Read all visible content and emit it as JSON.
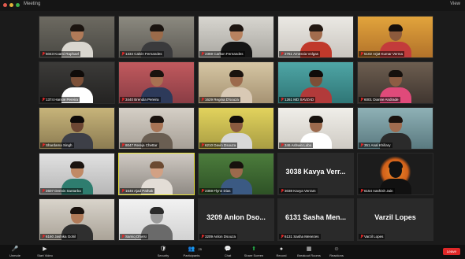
{
  "window": {
    "title": "Meeting",
    "view_label": "View"
  },
  "participants": [
    {
      "name": "5043 Koami Raphael",
      "look": "p1"
    },
    {
      "name": "1334 Calvin Fernandes",
      "look": "p2"
    },
    {
      "name": "2359 Carlton Fernandes",
      "look": "p3"
    },
    {
      "name": "2761 Amessia Volgas",
      "look": "p4"
    },
    {
      "name": "5102 Arjat Kumar Verma",
      "look": "p5"
    },
    {
      "name": "1374 Hansie Pereira",
      "look": "p6"
    },
    {
      "name": "3440 Brendia Pereira",
      "look": "p7"
    },
    {
      "name": "1629 Regina D'souza",
      "look": "p8"
    },
    {
      "name": "1261 MD SAVZAD",
      "look": "p9"
    },
    {
      "name": "6001 Dianne Andrade",
      "look": "p10"
    },
    {
      "name": "Shardama Singh",
      "look": "p11"
    },
    {
      "name": "8047 Rereja Chettar",
      "look": "p12"
    },
    {
      "name": "6210 Davin Dsouza",
      "look": "p13"
    },
    {
      "name": "346 Ashwin Lobo",
      "look": "p14"
    },
    {
      "name": "351 Anal Khillary",
      "look": "p15"
    },
    {
      "name": "2607 Dennis Santarba",
      "look": "p16"
    },
    {
      "name": "1646 Ajad Pathak",
      "look": "p17",
      "active": true
    },
    {
      "name": "2359 Flynn Dias",
      "look": "p18"
    },
    {
      "name": "3038 Kavya Verram",
      "big": "3038 Kavya Verr...",
      "look": "none"
    },
    {
      "name": "6154 Aashish Jain",
      "look": "p20"
    },
    {
      "name": "6160 Jashika Gohil",
      "look": "p21"
    },
    {
      "name": "Samiq Dhvrsi",
      "look": "p22"
    },
    {
      "name": "3209 Anlon Dsouza",
      "big": "3209 Anlon Dso...",
      "look": "none"
    },
    {
      "name": "6131 Sasha Menezes",
      "big": "6131 Sasha Men...",
      "look": "none"
    },
    {
      "name": "Varzil Lopes",
      "big": "Varzil Lopes",
      "look": "none"
    }
  ],
  "toolbar": {
    "items": [
      {
        "label": "Unmute",
        "icon": "🎤",
        "icon_name": "microphone-muted-icon"
      },
      {
        "label": "Start Video",
        "icon": "▶",
        "icon_name": "video-camera-icon"
      },
      {
        "label": "Security",
        "icon": "🛡",
        "icon_name": "shield-icon"
      },
      {
        "label": "Participants",
        "icon": "👥",
        "icon_name": "participants-icon",
        "count": "25"
      },
      {
        "label": "Chat",
        "icon": "💬",
        "icon_name": "chat-icon"
      },
      {
        "label": "Share Screen",
        "icon": "⬆",
        "icon_name": "share-screen-icon"
      },
      {
        "label": "Record",
        "icon": "●",
        "icon_name": "record-icon"
      },
      {
        "label": "Breakout Rooms",
        "icon": "▦",
        "icon_name": "breakout-rooms-icon"
      },
      {
        "label": "Reactions",
        "icon": "☺",
        "icon_name": "reactions-icon"
      }
    ],
    "leave_label": "Leave"
  },
  "colors": {
    "leave": "#e02828",
    "share": "#26b34a",
    "active_border": "#e7e23a"
  }
}
